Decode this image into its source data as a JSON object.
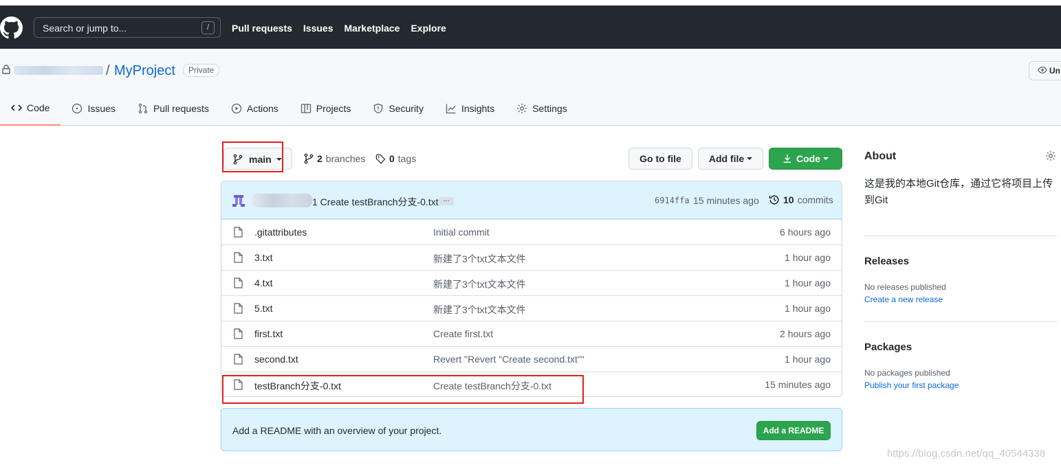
{
  "header": {
    "search_placeholder": "Search or jump to...",
    "search_key": "/",
    "nav": [
      "Pull requests",
      "Issues",
      "Marketplace",
      "Explore"
    ]
  },
  "repo": {
    "name": "MyProject",
    "visibility": "Private",
    "watch_label": "Un",
    "tabs": [
      {
        "label": "Code",
        "icon": "code-icon",
        "active": true
      },
      {
        "label": "Issues",
        "icon": "issue-icon"
      },
      {
        "label": "Pull requests",
        "icon": "pull-request-icon"
      },
      {
        "label": "Actions",
        "icon": "play-icon"
      },
      {
        "label": "Projects",
        "icon": "table-icon"
      },
      {
        "label": "Security",
        "icon": "shield-icon"
      },
      {
        "label": "Insights",
        "icon": "graph-icon"
      },
      {
        "label": "Settings",
        "icon": "gear-icon"
      }
    ]
  },
  "branchbar": {
    "branch": "main",
    "branches_count": "2",
    "branches_label": "branches",
    "tags_count": "0",
    "tags_label": "tags",
    "goto_file": "Go to file",
    "add_file": "Add file",
    "code": "Code"
  },
  "latest_commit": {
    "message": "1 Create testBranch分支-0.txt",
    "ellipsis": "…",
    "sha": "6914ffa",
    "time": "15 minutes ago",
    "commits_count": "10",
    "commits_label": "commits"
  },
  "files": [
    {
      "name": ".gitattributes",
      "message": "Initial commit",
      "age": "6 hours ago"
    },
    {
      "name": "3.txt",
      "message": "新建了3个txt文本文件",
      "age": "1 hour ago"
    },
    {
      "name": "4.txt",
      "message": "新建了3个txt文本文件",
      "age": "1 hour ago"
    },
    {
      "name": "5.txt",
      "message": "新建了3个txt文本文件",
      "age": "1 hour ago"
    },
    {
      "name": "first.txt",
      "message": "Create first.txt",
      "age": "2 hours ago"
    },
    {
      "name": "second.txt",
      "message": "Revert \"Revert \"Create second.txt\"\"",
      "age": "1 hour ago"
    },
    {
      "name": "testBranch分支-0.txt",
      "message": "Create testBranch分支-0.txt",
      "age": "15 minutes ago"
    }
  ],
  "readme": {
    "text": "Add a README with an overview of your project.",
    "button": "Add a README"
  },
  "sidebar": {
    "about_title": "About",
    "about_desc": "这是我的本地Git仓库，通过它将项目上传到Git",
    "releases_title": "Releases",
    "releases_empty": "No releases published",
    "releases_link": "Create a new release",
    "packages_title": "Packages",
    "packages_empty": "No packages published",
    "packages_link": "Publish your first package"
  },
  "watermark": "https://blog.csdn.net/qq_40544338",
  "colors": {
    "header_bg": "#24292f",
    "link": "#0969da",
    "primary_green": "#2da44e",
    "annotation_red": "#e02020",
    "tab_underline": "#fd8c73"
  }
}
